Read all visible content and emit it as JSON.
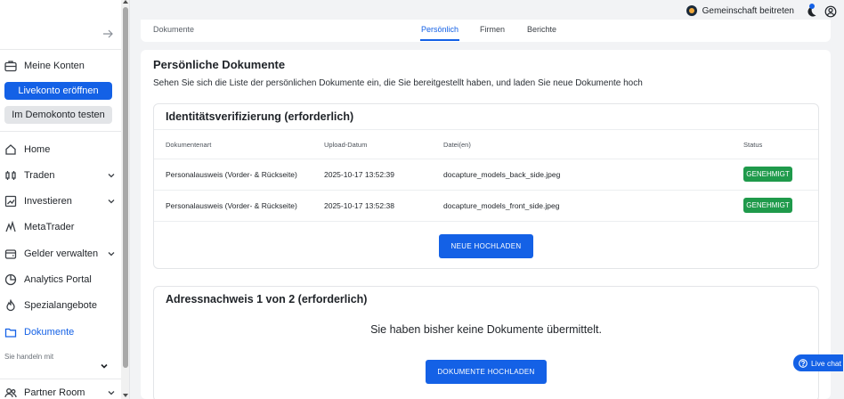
{
  "sidebar": {
    "my_accounts": "Meine Konten",
    "live_button": "Livekonto eröffnen",
    "demo_button": "Im Demokonto testen",
    "items": [
      {
        "label": "Home",
        "icon": "home-icon",
        "chevron": false
      },
      {
        "label": "Traden",
        "icon": "candles-icon",
        "chevron": true
      },
      {
        "label": "Investieren",
        "icon": "trend-icon",
        "chevron": true
      },
      {
        "label": "MetaTrader",
        "icon": "metatrader-icon",
        "chevron": false
      },
      {
        "label": "Gelder verwalten",
        "icon": "wallet-icon",
        "chevron": true
      },
      {
        "label": "Analytics Portal",
        "icon": "pie-chart-icon",
        "chevron": false
      },
      {
        "label": "Spezialangebote",
        "icon": "flame-icon",
        "chevron": false
      },
      {
        "label": "Dokumente",
        "icon": "folder-icon",
        "chevron": false,
        "active": true
      }
    ],
    "trade_with": "Sie handeln mit",
    "partner_room": "Partner Room"
  },
  "header": {
    "community": "Gemeinschaft beitreten",
    "accent": "#1461e6"
  },
  "tabs": {
    "crumb": "Dokumente",
    "items": [
      "Persönlich",
      "Firmen",
      "Berichte"
    ],
    "active": "Persönlich"
  },
  "main": {
    "title": "Persönliche Dokumente",
    "description": "Sehen Sie sich die Liste der persönlichen Dokumente ein, die Sie bereitgestellt haben, und laden Sie neue Dokumente hoch"
  },
  "identity": {
    "title": "Identitätsverifizierung (erforderlich)",
    "columns": [
      "Dokumentenart",
      "Upload-Datum",
      "Datei(en)",
      "Status"
    ],
    "rows": [
      {
        "type": "Personalausweis (Vorder- & Rückseite)",
        "date": "2025-10-17 13:52:39",
        "file": "docapture_models_back_side.jpeg",
        "status": "GENEHMIGT"
      },
      {
        "type": "Personalausweis (Vorder- & Rückseite)",
        "date": "2025-10-17 13:52:38",
        "file": "docapture_models_front_side.jpeg",
        "status": "GENEHMIGT"
      }
    ],
    "upload_button": "NEUE HOCHLADEN",
    "status_color": "#1f9a4b"
  },
  "address": {
    "title": "Adressnachweis 1 von 2 (erforderlich)",
    "empty": "Sie haben bisher keine Dokumente übermittelt.",
    "upload_button": "DOKUMENTE HOCHLADEN"
  },
  "livechat": {
    "label": "Live chat"
  }
}
